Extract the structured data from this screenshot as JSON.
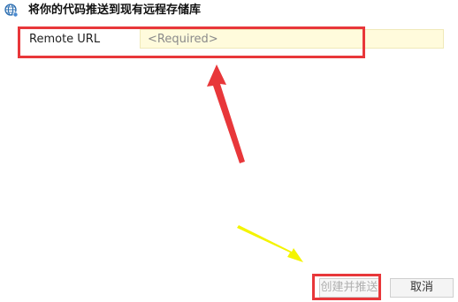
{
  "header": {
    "icon": "globe-network-icon",
    "title": "将你的代码推送到现有远程存储库"
  },
  "form": {
    "url_label": "Remote URL",
    "url_value": "",
    "url_placeholder": "<Required>"
  },
  "buttons": {
    "create_push_label": "创建并推送",
    "cancel_label": "取消"
  },
  "colors": {
    "annotation_red": "#e8373a",
    "annotation_yellow": "#f4f400",
    "input_bg": "#fffbdc"
  }
}
